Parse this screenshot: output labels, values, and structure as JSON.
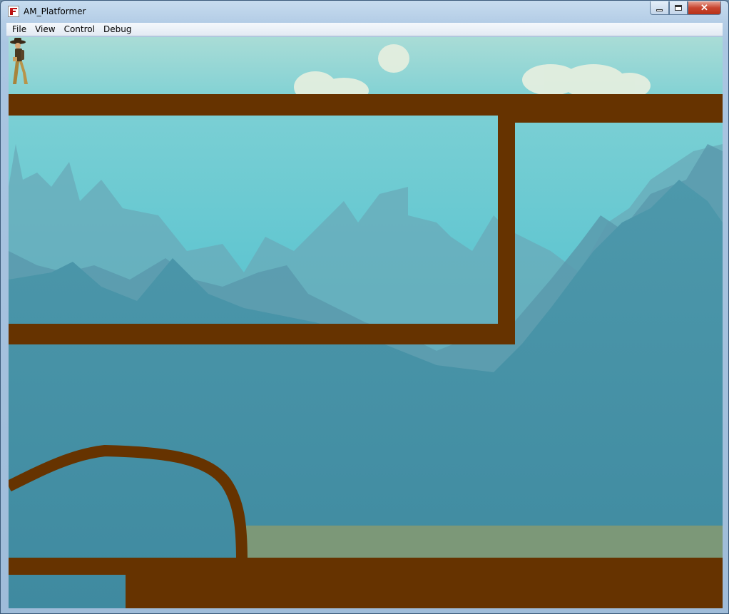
{
  "window": {
    "title": "AM_Platformer",
    "close_glyph": "✕"
  },
  "menu": {
    "items": [
      {
        "label": "File"
      },
      {
        "label": "View"
      },
      {
        "label": "Control"
      },
      {
        "label": "Debug"
      }
    ]
  },
  "icons": {
    "app": "flash-player-icon",
    "minimize": "minimize-icon",
    "maximize": "maximize-icon",
    "close": "close-icon"
  },
  "scene": {
    "sky_color": "#5cc4d0",
    "platform_color": "#663300",
    "ground_highlight_color": "#7c9878",
    "character": "player-explorer"
  }
}
